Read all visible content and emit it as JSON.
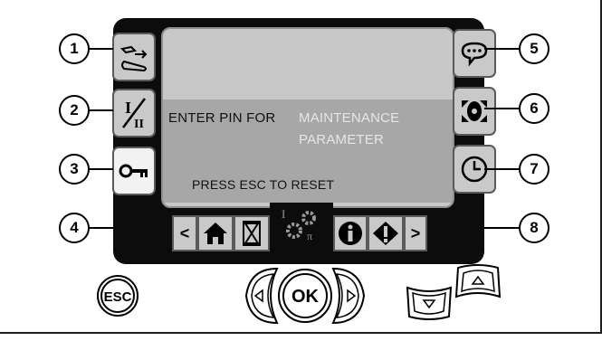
{
  "screen": {
    "line1_dark": "ENTER PIN FOR",
    "line1_light": "MAINTENANCE",
    "line2_light": "PARAMETER",
    "line3": "PRESS ESC TO RESET"
  },
  "callouts": {
    "c1": "1",
    "c2": "2",
    "c3": "3",
    "c4": "4",
    "c5": "5",
    "c6": "6",
    "c7": "7",
    "c8": "8"
  },
  "left_buttons": {
    "b1_icon": "cable-settings-icon",
    "b2_label_top": "I",
    "b2_label_bottom": "II",
    "b3_icon": "key-icon"
  },
  "right_buttons": {
    "b5_icon": "speech-bubble-icon",
    "b6_icon": "fan-icon",
    "b7_icon": "clock-icon"
  },
  "bottom_tabs": {
    "prev": "<",
    "home_icon": "home-icon",
    "hourglass_icon": "hourglass-icon",
    "center_icon": "gear-mode-icon",
    "center_small": "I",
    "center_sub": "π",
    "info_icon": "info-icon",
    "warning_icon": "warning-icon",
    "next": ">"
  },
  "hardware": {
    "esc_label": "ESC",
    "ok_label": "OK"
  },
  "colors": {
    "screen_bg": "#c8c8c8",
    "panel_bg": "#0c0c0c",
    "button_bg": "#c9c9c9"
  }
}
